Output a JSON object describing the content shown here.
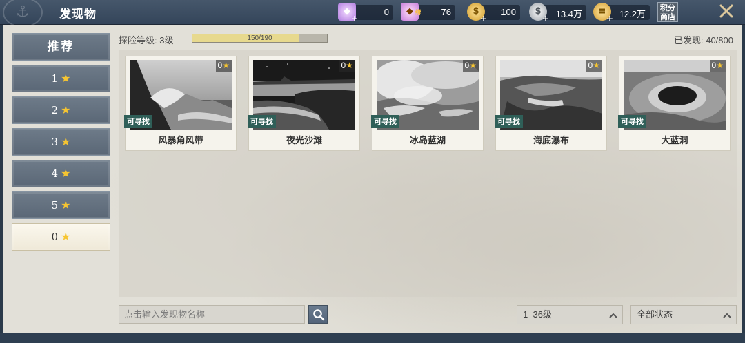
{
  "header": {
    "title": "发现物",
    "currencies": [
      {
        "icon": "purple-gem-icon",
        "value": "0"
      },
      {
        "icon": "bound-purple-gem-icon",
        "value": "76"
      },
      {
        "icon": "gold-coin-icon",
        "value": "100"
      },
      {
        "icon": "silver-coin-icon",
        "value": "13.4万"
      },
      {
        "icon": "gold-coins-stack-icon",
        "value": "12.2万"
      }
    ],
    "shop_label_line1": "积分",
    "shop_label_line2": "商店",
    "gem_bound_tag": "绑"
  },
  "sidebar": {
    "recommend": "推荐",
    "tabs": [
      "1",
      "2",
      "3",
      "4",
      "5",
      "0"
    ],
    "active_tab": "0"
  },
  "explore": {
    "level_label": "探险等级: 3级",
    "progress_text": "150/190",
    "progress_fraction": 0.789,
    "discovered_label": "已发现: 40/800"
  },
  "cards": [
    {
      "name": "风暴角风带",
      "count": "0",
      "badge": "可寻找"
    },
    {
      "name": "夜光沙滩",
      "count": "0",
      "badge": "可寻找"
    },
    {
      "name": "冰岛蓝湖",
      "count": "0",
      "badge": "可寻找"
    },
    {
      "name": "海底瀑布",
      "count": "0",
      "badge": "可寻找"
    },
    {
      "name": "大蓝洞",
      "count": "0",
      "badge": "可寻找"
    }
  ],
  "search": {
    "placeholder": "点击输入发现物名称"
  },
  "filters": {
    "level": "1–36级",
    "status": "全部状态"
  },
  "colors": {
    "accent_star": "#f6c531",
    "badge_bg": "#2f5f58",
    "topbar": "#3d4e62"
  }
}
